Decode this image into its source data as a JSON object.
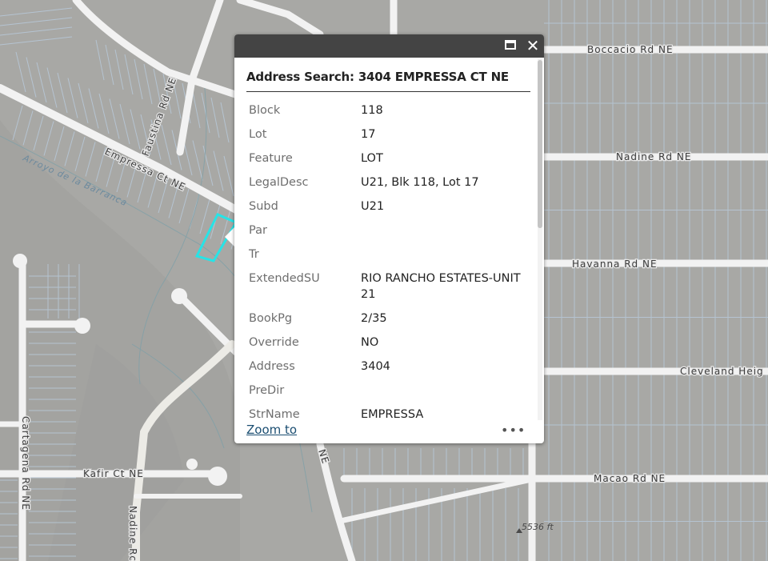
{
  "map": {
    "road_labels": {
      "boccacio": "Boccacio Rd NE",
      "nadine_rd": "Nadine Rd NE",
      "havanna": "Havanna Rd NE",
      "cleveland": "Cleveland Heig",
      "macao": "Macao Rd NE",
      "kafir": "Kafir Ct NE",
      "cartagena": "Cartagena Rd NE",
      "nadine_vert": "Nadine Rc",
      "faustina": "Faustina Rd NE",
      "empressa": "Empressa Ct NE",
      "ne_fragment": "NE"
    },
    "water_label": "Arroyo de la Barranca",
    "elevation_label": "5536 ft",
    "highlight_color": "#27e3e6",
    "road_color": "#f2f2f2",
    "parcel_line_color": "#b7c7d6"
  },
  "popup": {
    "title": "Address Search: 3404 EMPRESSA CT NE",
    "maximize_icon": "maximize-icon",
    "close_icon": "close-icon",
    "attributes": [
      {
        "key": "Block",
        "value": "118"
      },
      {
        "key": "Lot",
        "value": "17"
      },
      {
        "key": "Feature",
        "value": "LOT"
      },
      {
        "key": "LegalDesc",
        "value": "U21, Blk 118, Lot 17"
      },
      {
        "key": "Subd",
        "value": "U21"
      },
      {
        "key": "Par",
        "value": ""
      },
      {
        "key": "Tr",
        "value": ""
      },
      {
        "key": "ExtendedSU",
        "value": "RIO RANCHO ESTATES-UNIT 21"
      },
      {
        "key": "BookPg",
        "value": "2/35"
      },
      {
        "key": "Override",
        "value": "NO"
      },
      {
        "key": "Address",
        "value": "3404"
      },
      {
        "key": "PreDir",
        "value": ""
      },
      {
        "key": "StrName",
        "value": "EMPRESSA"
      }
    ],
    "zoom_to": "Zoom to",
    "more": "•••"
  }
}
